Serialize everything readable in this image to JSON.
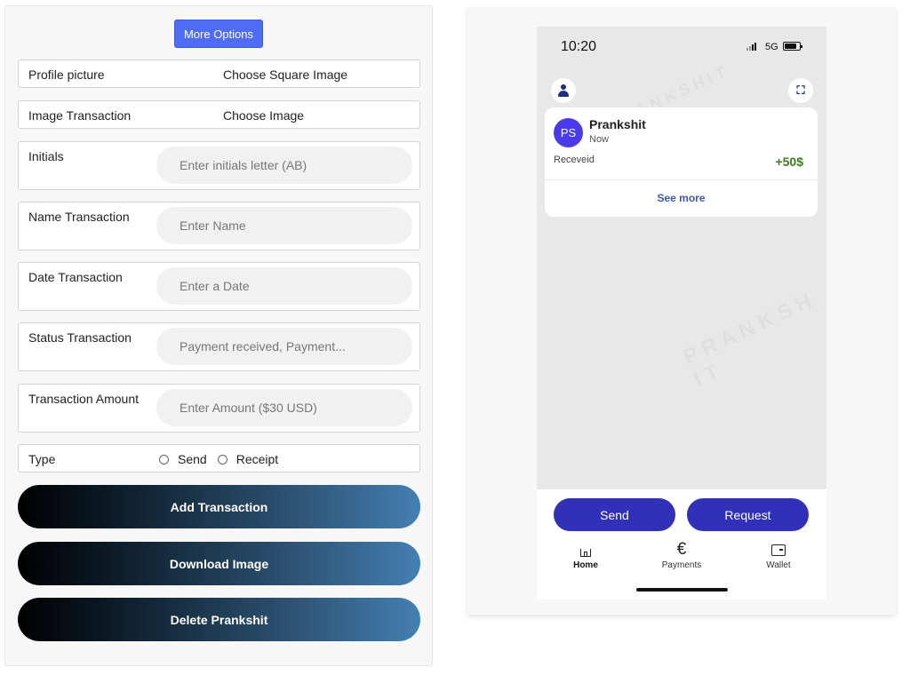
{
  "editor": {
    "more_options": "More Options",
    "profile_picture": {
      "label": "Profile picture",
      "action": "Choose Square Image"
    },
    "image_transaction": {
      "label": "Image Transaction",
      "action": "Choose Image"
    },
    "initials": {
      "label": "Initials",
      "placeholder": "Enter initials letter (AB)"
    },
    "name": {
      "label": "Name Transaction",
      "placeholder": "Enter Name"
    },
    "date": {
      "label": "Date Transaction",
      "placeholder": "Enter a Date"
    },
    "status": {
      "label": "Status Transaction",
      "placeholder": "Payment received, Payment..."
    },
    "amount": {
      "label": "Transaction Amount",
      "placeholder": "Enter Amount ($30 USD)"
    },
    "type": {
      "label": "Type",
      "options": [
        "Send",
        "Receipt"
      ]
    },
    "buttons": {
      "add": "Add Transaction",
      "download": "Download Image",
      "delete": "Delete Prankshit"
    }
  },
  "preview": {
    "status_bar": {
      "time": "10:20",
      "network": "5G"
    },
    "transaction": {
      "initials": "PS",
      "name": "Prankshit",
      "date": "Now",
      "status": "Receveid",
      "amount": "+50$",
      "see_more": "See more"
    },
    "actions": {
      "send": "Send",
      "request": "Request"
    },
    "nav": [
      {
        "label": "Home",
        "icon": "home-icon",
        "active": true
      },
      {
        "label": "Payments",
        "icon": "euro-icon",
        "active": false
      },
      {
        "label": "Wallet",
        "icon": "wallet-icon",
        "active": false
      }
    ],
    "colors": {
      "avatar": "#4b39ef",
      "primary_button": "#3130b8",
      "amount_positive": "#3a7d1e",
      "more_options": "#4f6cf5"
    }
  }
}
